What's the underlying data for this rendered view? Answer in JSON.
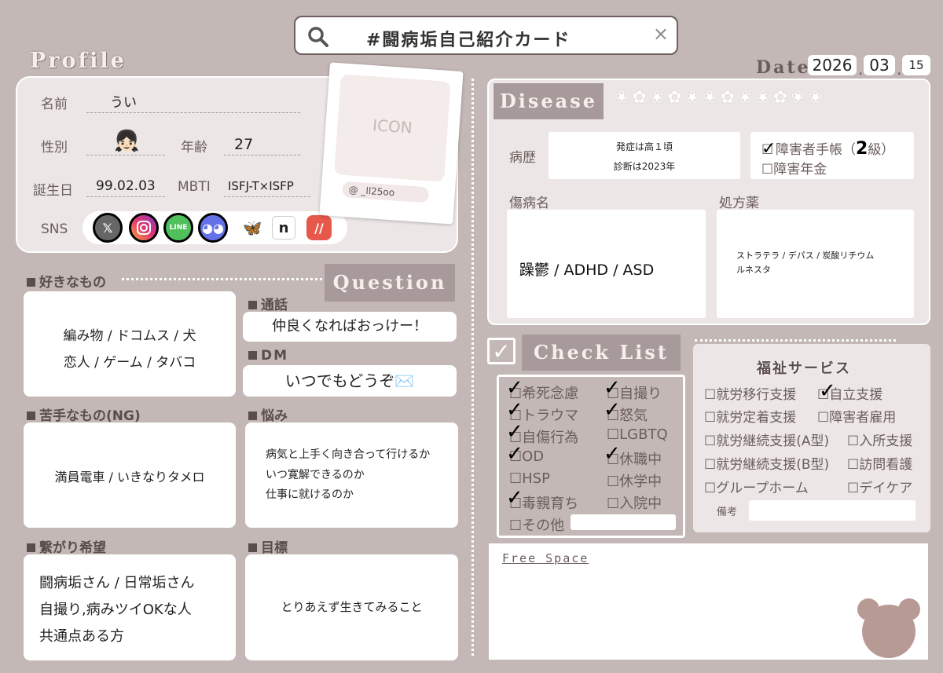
{
  "search": {
    "text": "#闘病垢自己紹介カード",
    "close": "×"
  },
  "profile_title": "Profile",
  "date": {
    "label": "Date",
    "year": "2026",
    "month": "03",
    "day": "15",
    "sep": "."
  },
  "profile": {
    "name_label": "名前",
    "name": "うい",
    "gender_label": "性別",
    "gender_emoji": "👧🏻",
    "age_label": "年齢",
    "age": "27",
    "birthday_label": "誕生日",
    "birthday": "99.02.03",
    "mbti_label": "MBTI",
    "mbti": "ISFJ-T×ISFP",
    "sns_label": "SNS",
    "icon_text": "ICON",
    "handle": "@ _ll25oo"
  },
  "sns_icons": [
    "x-icon",
    "instagram-icon",
    "line-icon",
    "discord-icon",
    "bluesky-icon",
    "note-icon",
    "misskey-icon"
  ],
  "likes": {
    "label": "好きなもの",
    "line1": "編み物 / ドコムス / 犬",
    "line2": "恋人 / ゲーム / タバコ"
  },
  "question_title": "Question",
  "call": {
    "label": "通話",
    "value": "仲良くなればおっけー！"
  },
  "dm": {
    "label": "DM",
    "value": "いつでもどうぞ✉️"
  },
  "dislikes": {
    "label": "苦手なもの(NG)",
    "value": "満員電車 / いきなりタメロ"
  },
  "worries": {
    "label": "悩み",
    "line1": "病気と上手く向き合って行けるか",
    "line2": "いつ寛解できるのか",
    "line3": "仕事に就けるのか"
  },
  "connect": {
    "label": "繋がり希望",
    "line1": "闘病垢さん / 日常垢さん",
    "line2": "自撮り,病みツイOKな人",
    "line3": "共通点ある方"
  },
  "goal": {
    "label": "目標",
    "value": "とりあえず生きてみること"
  },
  "disease_title": "Disease",
  "history": {
    "label": "病歴",
    "line1": "発症は高１頃",
    "line2": "診断は2023年"
  },
  "handbook": {
    "line1": "障害者手帳（",
    "grade": "2",
    "line1b": "級）",
    "line2": "障害年金"
  },
  "diagnosis": {
    "label": "傷病名",
    "value": "躁鬱 / ADHD / ASD"
  },
  "meds": {
    "label": "処方薬",
    "line1": "ストラテラ / デパス / 炭酸リチウム",
    "line2": "ルネスタ"
  },
  "checklist_title": "Check List",
  "checklist": [
    {
      "label": "希死念慮",
      "checked": true
    },
    {
      "label": "自撮り",
      "checked": true
    },
    {
      "label": "トラウマ",
      "checked": true
    },
    {
      "label": "怒気",
      "checked": true
    },
    {
      "label": "自傷行為",
      "checked": true
    },
    {
      "label": "LGBTQ",
      "checked": false
    },
    {
      "label": "OD",
      "checked": true
    },
    {
      "label": "休職中",
      "checked": true
    },
    {
      "label": "HSP",
      "checked": false
    },
    {
      "label": "休学中",
      "checked": false
    },
    {
      "label": "毒親育ち",
      "checked": true
    },
    {
      "label": "入院中",
      "checked": false
    },
    {
      "label": "その他",
      "checked": false
    }
  ],
  "welfare": {
    "title": "福祉サービス",
    "items": [
      {
        "label": "就労移行支援",
        "checked": false
      },
      {
        "label": "自立支援",
        "checked": true
      },
      {
        "label": "就労定着支援",
        "checked": false
      },
      {
        "label": "障害者雇用",
        "checked": false
      },
      {
        "label": "就労継続支援(A型)",
        "checked": false
      },
      {
        "label": "入所支援",
        "checked": false
      },
      {
        "label": "就労継続支援(B型)",
        "checked": false
      },
      {
        "label": "訪問看護",
        "checked": false
      },
      {
        "label": "グループホーム",
        "checked": false
      },
      {
        "label": "デイケア",
        "checked": false
      }
    ],
    "note_label": "備考"
  },
  "free_space_title": "Free Space",
  "box_glyph": "☐",
  "check_glyph": "✓"
}
